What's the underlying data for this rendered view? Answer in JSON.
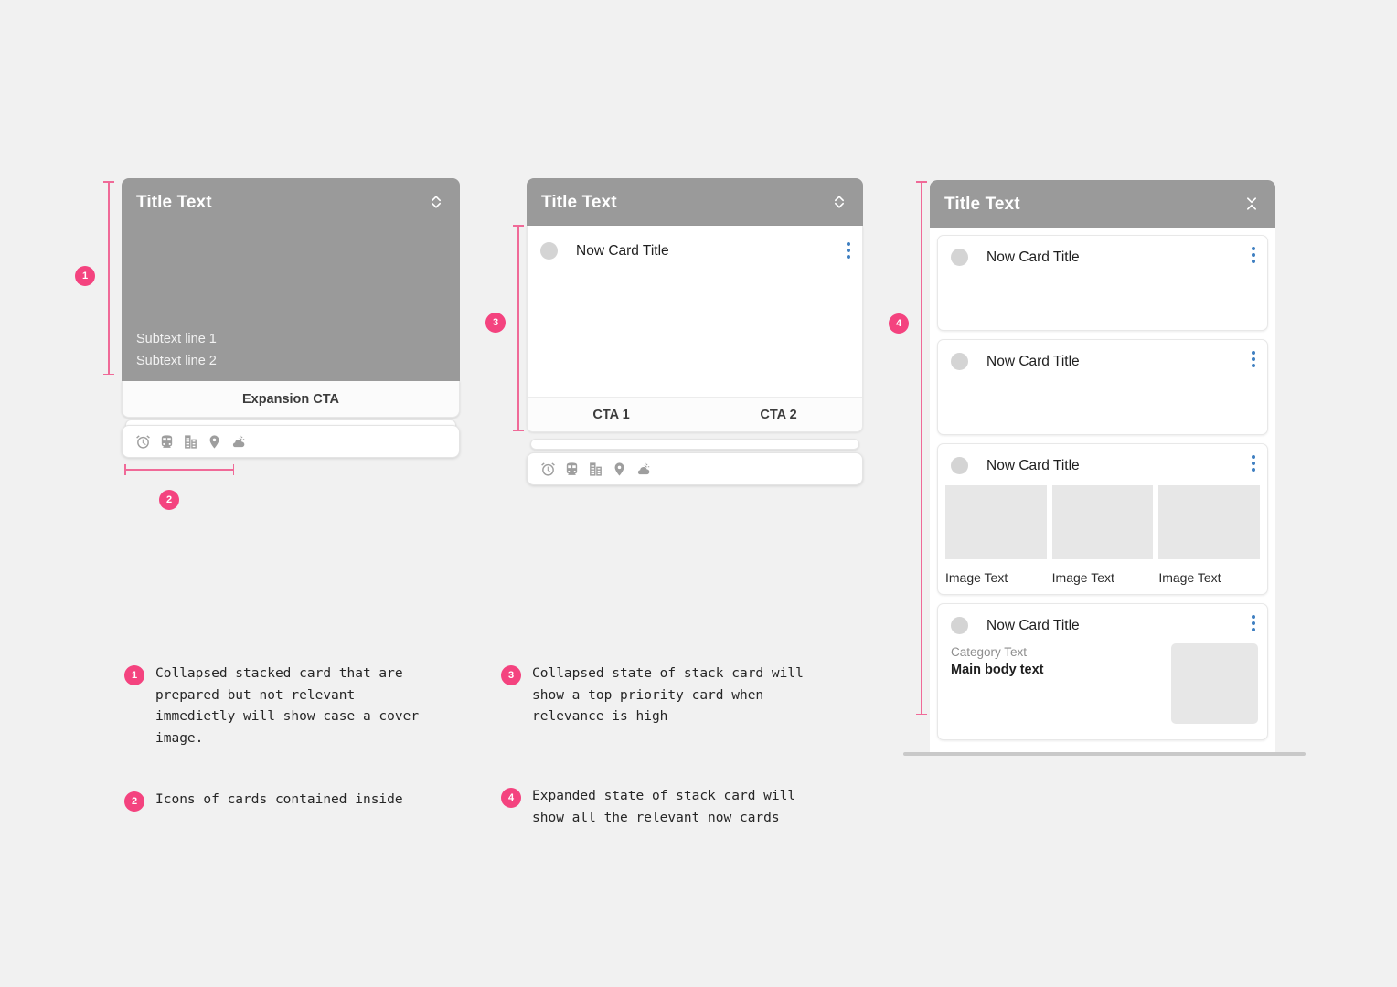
{
  "page": {
    "background": "#f1f1f1",
    "accent": "#f4437f",
    "rule_color": "#f06a98",
    "header_gray": "#9a9a9a",
    "kebab_blue": "#3f7fc1",
    "placeholder_gray": "#e7e7e7"
  },
  "card1": {
    "name": "collapsed-stacked-cover-card",
    "title": "Title Text",
    "header_icon": "unfold-more-icon",
    "subtext_line_1": "Subtext line 1",
    "subtext_line_2": "Subtext line 2",
    "expansion_cta": "Expansion CTA",
    "icons": [
      "alarm-clock-icon",
      "train-icon",
      "hotel-icon",
      "location-pin-icon",
      "partly-cloudy-icon"
    ]
  },
  "card3": {
    "name": "collapsed-stack-card-with-top-priority",
    "title": "Title Text",
    "header_icon": "unfold-more-icon",
    "now_card": {
      "title": "Now Card Title",
      "avatar": "avatar-circle",
      "menu": "kebab-menu-icon"
    },
    "cta_1": "CTA 1",
    "cta_2": "CTA 2",
    "icons": [
      "alarm-clock-icon",
      "train-icon",
      "hotel-icon",
      "location-pin-icon",
      "partly-cloudy-icon"
    ]
  },
  "card4": {
    "name": "expanded-stack-card",
    "title": "Title Text",
    "header_icon": "unfold-less-icon",
    "now_cards": [
      {
        "title": "Now Card Title",
        "type": "plain"
      },
      {
        "title": "Now Card Title",
        "type": "plain"
      },
      {
        "title": "Now Card Title",
        "type": "image-gallery",
        "images": [
          {
            "caption": "Image Text"
          },
          {
            "caption": "Image Text"
          },
          {
            "caption": "Image Text"
          }
        ]
      },
      {
        "title": "Now Card Title",
        "type": "body-with-thumb",
        "category_text": "Category Text",
        "main_body_text": "Main body text"
      }
    ]
  },
  "markers": [
    {
      "id": "1",
      "label": "1"
    },
    {
      "id": "2",
      "label": "2"
    },
    {
      "id": "3",
      "label": "3"
    },
    {
      "id": "4",
      "label": "4"
    }
  ],
  "notes": [
    {
      "num": "1",
      "text": "Collapsed stacked card that are\nprepared but not relevant\nimmedietly will show case a cover\nimage."
    },
    {
      "num": "2",
      "text": "Icons of cards contained inside"
    },
    {
      "num": "3",
      "text": "Collapsed state of stack card will\nshow a top priority card when\nrelevance is high"
    },
    {
      "num": "4",
      "text": "Expanded state of stack card will\nshow all the relevant now cards"
    }
  ]
}
